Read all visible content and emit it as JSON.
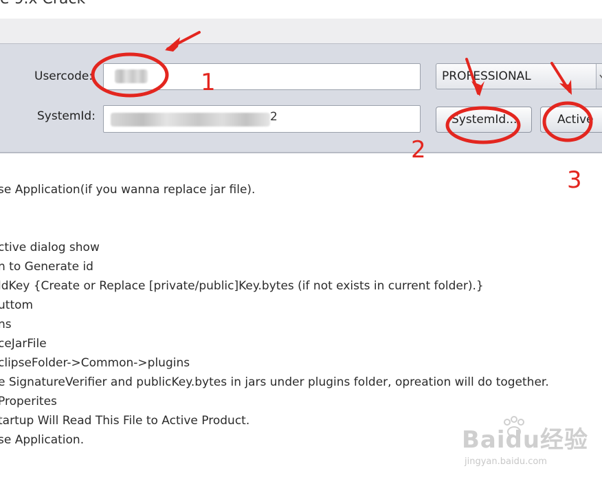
{
  "window": {
    "title": "e 9.x Crack"
  },
  "form": {
    "usercode_label": "Usercode:",
    "systemid_label": "SystemId:",
    "systemid_tail": "2",
    "edition_value": "PROFESSIONAL",
    "systemid_button": "SystemId...",
    "active_button": "Active"
  },
  "annotations": {
    "step1": "1",
    "step2": "2",
    "step3": "3",
    "annotation_color": "#e3261f"
  },
  "instructions": [
    "se Application(if you wanna replace jar file).",
    "ctive dialog show",
    "n to Generate id",
    "ldKey {Create or Replace [private/public]Key.bytes (if not exists in current folder).}",
    "uttom",
    "ns",
    "ceJarFile",
    "clipseFolder->Common->plugins",
    "e SignatureVerifier and publicKey.bytes in jars under plugins folder, opreation will do together.",
    "Properites",
    "tartup Will Read This File to Active Product.",
    "se Application."
  ],
  "watermark": {
    "brand": "Baidu经验",
    "url": "jingyan.baidu.com"
  },
  "colors": {
    "panel_bg": "#d9dce4",
    "accent_red": "#e3261f"
  }
}
